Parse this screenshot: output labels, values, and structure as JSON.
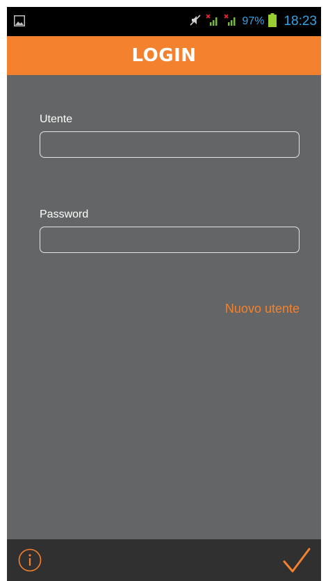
{
  "status_bar": {
    "battery_percent": "97%",
    "time": "18:23",
    "icons": [
      "gallery-icon",
      "mute-icon",
      "no-signal-icon",
      "no-signal-icon",
      "battery-icon"
    ],
    "accent_color": "#35a4e6"
  },
  "header": {
    "title": "LOGIN",
    "background_color": "#f4812d"
  },
  "form": {
    "username": {
      "label": "Utente",
      "value": "",
      "placeholder": ""
    },
    "password": {
      "label": "Password",
      "value": "",
      "placeholder": ""
    },
    "new_user_link": "Nuovo utente"
  },
  "bottom_bar": {
    "info_icon": "info-icon",
    "confirm_icon": "checkmark-icon"
  },
  "colors": {
    "background": "#646566",
    "accent": "#f4812d",
    "bottom_bar": "#303030"
  }
}
